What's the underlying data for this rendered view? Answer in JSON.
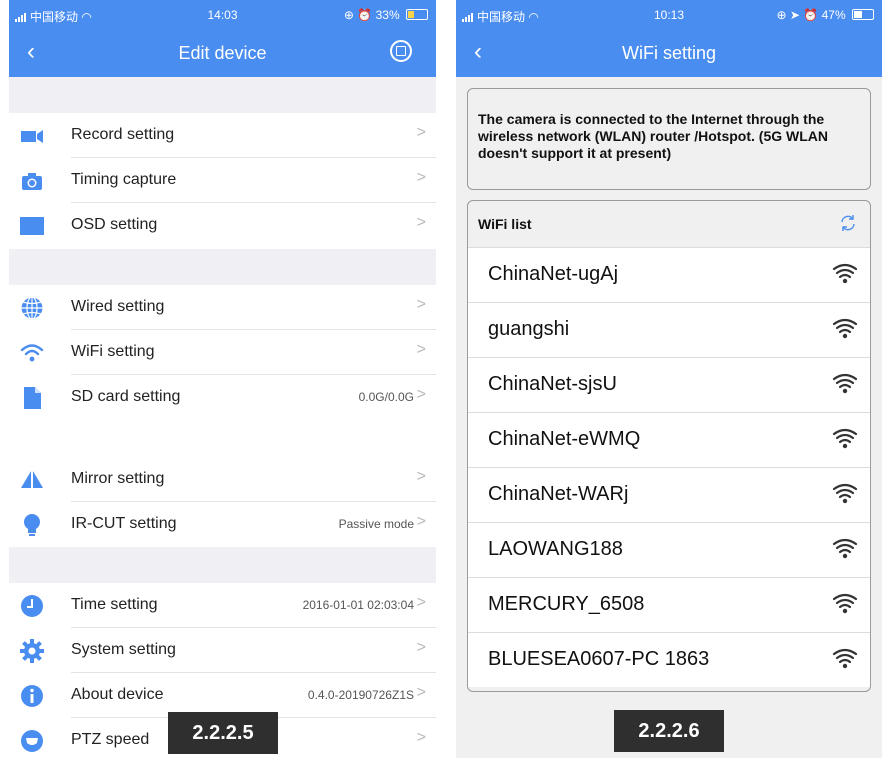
{
  "left": {
    "status": {
      "carrier": "中国移动",
      "time": "14:03",
      "battery": "33%",
      "battery_level": 0.33
    },
    "nav": {
      "title": "Edit device",
      "back_icon": "chevron-left-icon",
      "save_icon": "save-icon"
    },
    "groups": [
      [
        {
          "label": "Record setting",
          "value": "",
          "icon": "video-camera-icon"
        },
        {
          "label": "Timing capture",
          "value": "",
          "icon": "camera-icon"
        },
        {
          "label": "OSD setting",
          "value": "",
          "icon": "osd-icon"
        }
      ],
      [
        {
          "label": "Wired setting",
          "value": "",
          "icon": "globe-icon"
        },
        {
          "label": "WiFi setting",
          "value": "",
          "icon": "wifi-icon"
        },
        {
          "label": "SD card setting",
          "value": "0.0G/0.0G",
          "icon": "sd-card-icon"
        }
      ],
      [
        {
          "label": "Mirror setting",
          "value": "",
          "icon": "mirror-icon"
        },
        {
          "label": "IR-CUT setting",
          "value": "Passive mode",
          "icon": "bulb-icon"
        }
      ],
      [
        {
          "label": "Time setting",
          "value": "2016-01-01 02:03:04",
          "icon": "clock-icon"
        },
        {
          "label": "System setting",
          "value": "",
          "icon": "gear-icon"
        },
        {
          "label": "About device",
          "value": "0.4.0-20190726Z1S",
          "icon": "info-icon"
        },
        {
          "label": "PTZ speed",
          "value": "",
          "icon": "ptz-icon"
        }
      ]
    ],
    "badge": "2.2.2.5"
  },
  "right": {
    "status": {
      "carrier": "中国移动",
      "time": "10:13",
      "battery": "47%",
      "battery_level": 0.47
    },
    "nav": {
      "title": "WiFi setting",
      "back_icon": "chevron-left-icon"
    },
    "notice": "The camera is connected to the Internet through the wireless network (WLAN) router /Hotspot. (5G WLAN doesn't support it at present)",
    "wifi_list_title": "WiFi list",
    "networks": [
      "ChinaNet-ugAj",
      "guangshi",
      "ChinaNet-sjsU",
      "ChinaNet-eWMQ",
      "ChinaNet-WARj",
      "LAOWANG188",
      "MERCURY_6508",
      "BLUESEA0607-PC 1863"
    ],
    "badge": "2.2.2.6"
  },
  "colors": {
    "accent": "#4a8df0",
    "badge_bg": "#2f2f2f",
    "battery_fill": "#f7d34a"
  }
}
